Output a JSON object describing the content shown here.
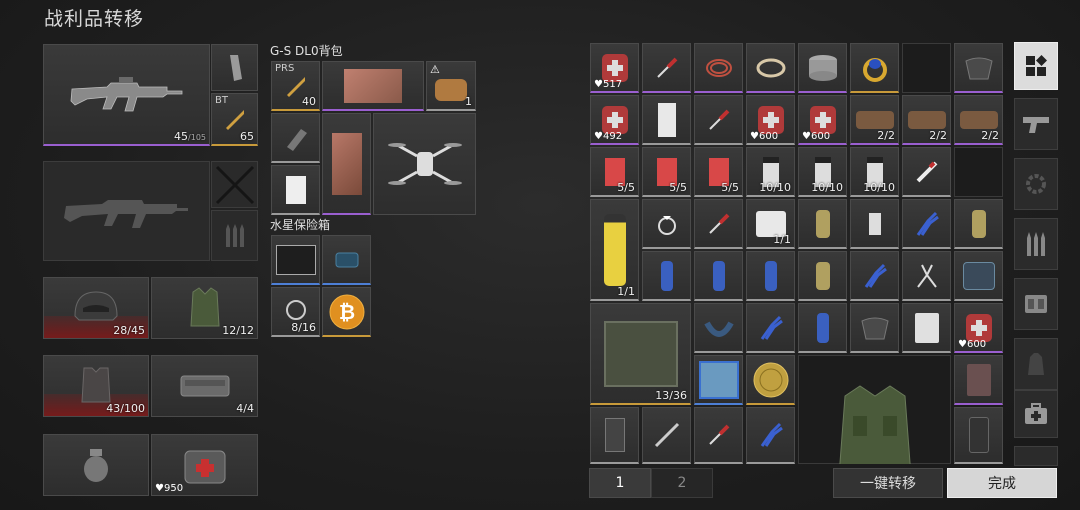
{
  "screen_title": "战利品转移",
  "player": {
    "primary_weapon": {
      "ammo_label": "BT",
      "ammo_count": "65",
      "mag": "45",
      "mag_max": "/105"
    },
    "helmet": {
      "durability": "28/45"
    },
    "rig": {
      "count": "12/12"
    },
    "armor": {
      "durability": "43/100"
    },
    "pouch": {
      "count": "4/4"
    },
    "medkit": {
      "hp": "950"
    }
  },
  "backpack": {
    "title": "G-S DL0背包",
    "ammo_label": "PRS",
    "ammo_count": "40",
    "warn_item_count": "1"
  },
  "safe_box": {
    "title": "水星保险箱",
    "cable_count": "8/16"
  },
  "loot": {
    "medbag1": "517",
    "medbag2": "492",
    "medbag3": "600",
    "medbag4": "600",
    "bandage": "2/2",
    "box": "5/5",
    "pills": "10/10",
    "drink": "1/1",
    "cream": "1/1",
    "medbag5": "600",
    "case": "13/36"
  },
  "pages": [
    "1",
    "2"
  ],
  "actions": {
    "transfer_all": "一键转移",
    "done": "完成"
  },
  "side_tabs": [
    "all-icon",
    "pistol-icon",
    "gear-part-icon",
    "ammo-icon",
    "armor-vest-icon",
    "backpack-icon",
    "medkit-icon"
  ]
}
